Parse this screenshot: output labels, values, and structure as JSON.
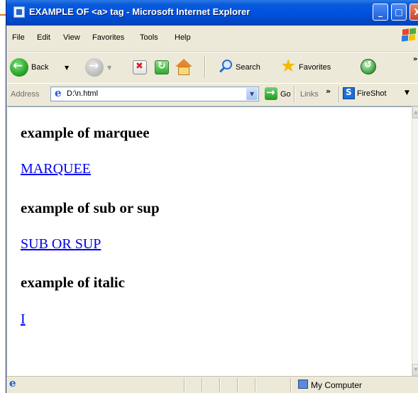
{
  "window": {
    "title": "EXAMPLE OF <a> tag - Microsoft Internet Explorer",
    "buttons": {
      "minimize": "_",
      "maximize": "□",
      "close": "X"
    }
  },
  "menu": [
    "File",
    "Edit",
    "View",
    "Favorites",
    "Tools",
    "Help"
  ],
  "toolbar": {
    "back_label": "Back",
    "search_label": "Search",
    "favorites_label": "Favorites",
    "overflow": "»"
  },
  "address": {
    "label": "Address",
    "value": "D:\\n.html",
    "go_label": "Go",
    "links_label": "Links",
    "links_chevron": "»",
    "fireshot_label": "FireShot"
  },
  "content": {
    "heading_marquee": "example of marquee",
    "link_marquee": "MARQUEE",
    "heading_subsup": "example of sub or sup",
    "link_subsup": "SUB OR SUP",
    "heading_italic": "example of italic",
    "link_italic": "I"
  },
  "status": {
    "zone_label": "My Computer"
  },
  "colors": {
    "titlebar": "#0054e3",
    "link": "#0000ee",
    "chrome": "#ece9d8"
  },
  "icons": [
    "ie-icon",
    "back-icon",
    "forward-icon",
    "stop-icon",
    "refresh-icon",
    "home-icon",
    "search-icon",
    "favorites-star-icon",
    "history-icon",
    "go-icon",
    "fireshot-icon",
    "windows-logo-icon",
    "my-computer-icon"
  ]
}
